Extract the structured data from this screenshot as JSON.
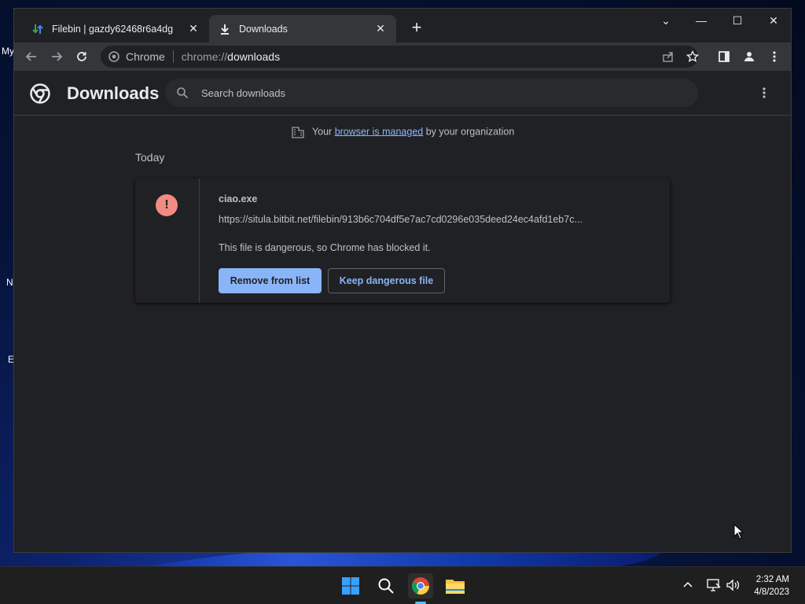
{
  "desktop": {
    "labels": [
      "My",
      "N",
      "E"
    ]
  },
  "browser": {
    "tabs": [
      {
        "title": "Filebin | gazdy62468r6a4dg",
        "icon": "filebin-icon",
        "close": "✕"
      },
      {
        "title": "Downloads",
        "icon": "download-icon",
        "close": "✕"
      }
    ],
    "new_tab": "+",
    "window_controls": {
      "tab_search": "⌄",
      "minimize": "—",
      "maximize": "☐",
      "close": "✕"
    },
    "omnibox": {
      "site_chip": "Chrome",
      "url_scheme": "chrome://",
      "url_host": "downloads"
    }
  },
  "downloads_page": {
    "title": "Downloads",
    "search_placeholder": "Search downloads",
    "managed_notice": {
      "prefix": "Your ",
      "link": "browser is managed",
      "suffix": " by your organization"
    },
    "date_header": "Today",
    "items": [
      {
        "filename": "ciao.exe",
        "url": "https://situla.bitbit.net/filebin/913b6c704df5e7ac7cd0296e035deed24ec4afd1eb7c...",
        "status": "This file is dangerous, so Chrome has blocked it.",
        "primary_button": "Remove from list",
        "secondary_button": "Keep dangerous file"
      }
    ]
  },
  "taskbar": {
    "time": "2:32 AM",
    "date": "4/8/2023"
  },
  "colors": {
    "accent": "#8ab4f8",
    "danger": "#f28b82",
    "page_bg": "#202124",
    "toolbar_bg": "#35363a"
  }
}
